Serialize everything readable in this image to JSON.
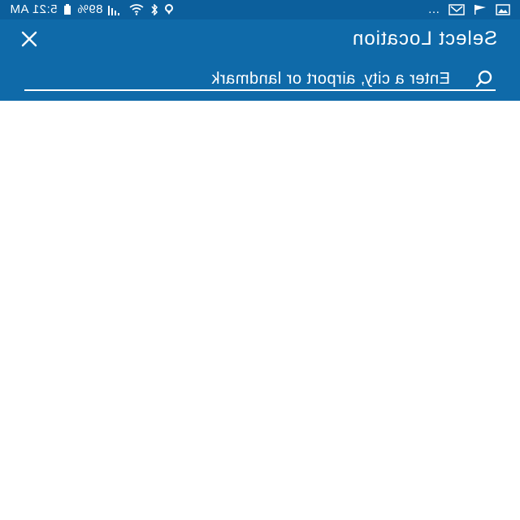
{
  "status_bar": {
    "time": "5:21 AM",
    "battery_percent": "89%",
    "overflow": "…",
    "icons": [
      "gallery-icon",
      "mail-icon",
      "flag-icon",
      "more-icon",
      "location-icon",
      "bluetooth-icon",
      "wifi-icon",
      "signal-icon",
      "battery-icon"
    ]
  },
  "app_bar": {
    "title": "Select Location",
    "close_icon": "close-icon"
  },
  "search": {
    "placeholder": "Enter a city, airport or landmark",
    "value": "",
    "icon": "search-icon"
  },
  "colors": {
    "status_bar": "#0c5f9c",
    "app_bar": "#0f6aa9",
    "text": "#ffffff",
    "background": "#ffffff"
  }
}
